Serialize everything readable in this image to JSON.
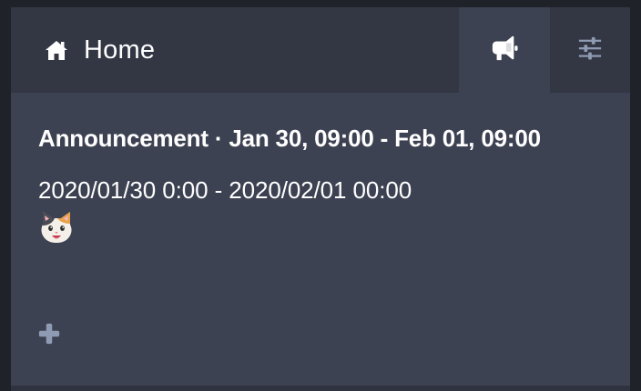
{
  "header": {
    "home_label": "Home",
    "home_icon": "home-icon",
    "announcements_icon": "megaphone-icon",
    "settings_icon": "sliders-icon"
  },
  "announcement": {
    "title": "Announcement · Jan 30, 09:00 - Feb 01, 09:00",
    "body": "2020/01/30 0:00 - 2020/02/01 00:00",
    "emoji": "cat-face"
  },
  "actions": {
    "add_icon": "plus-icon"
  },
  "colors": {
    "background": "#3d4252",
    "header": "#333744",
    "text": "#ffffff",
    "muted_icon": "#8f9bb3"
  }
}
